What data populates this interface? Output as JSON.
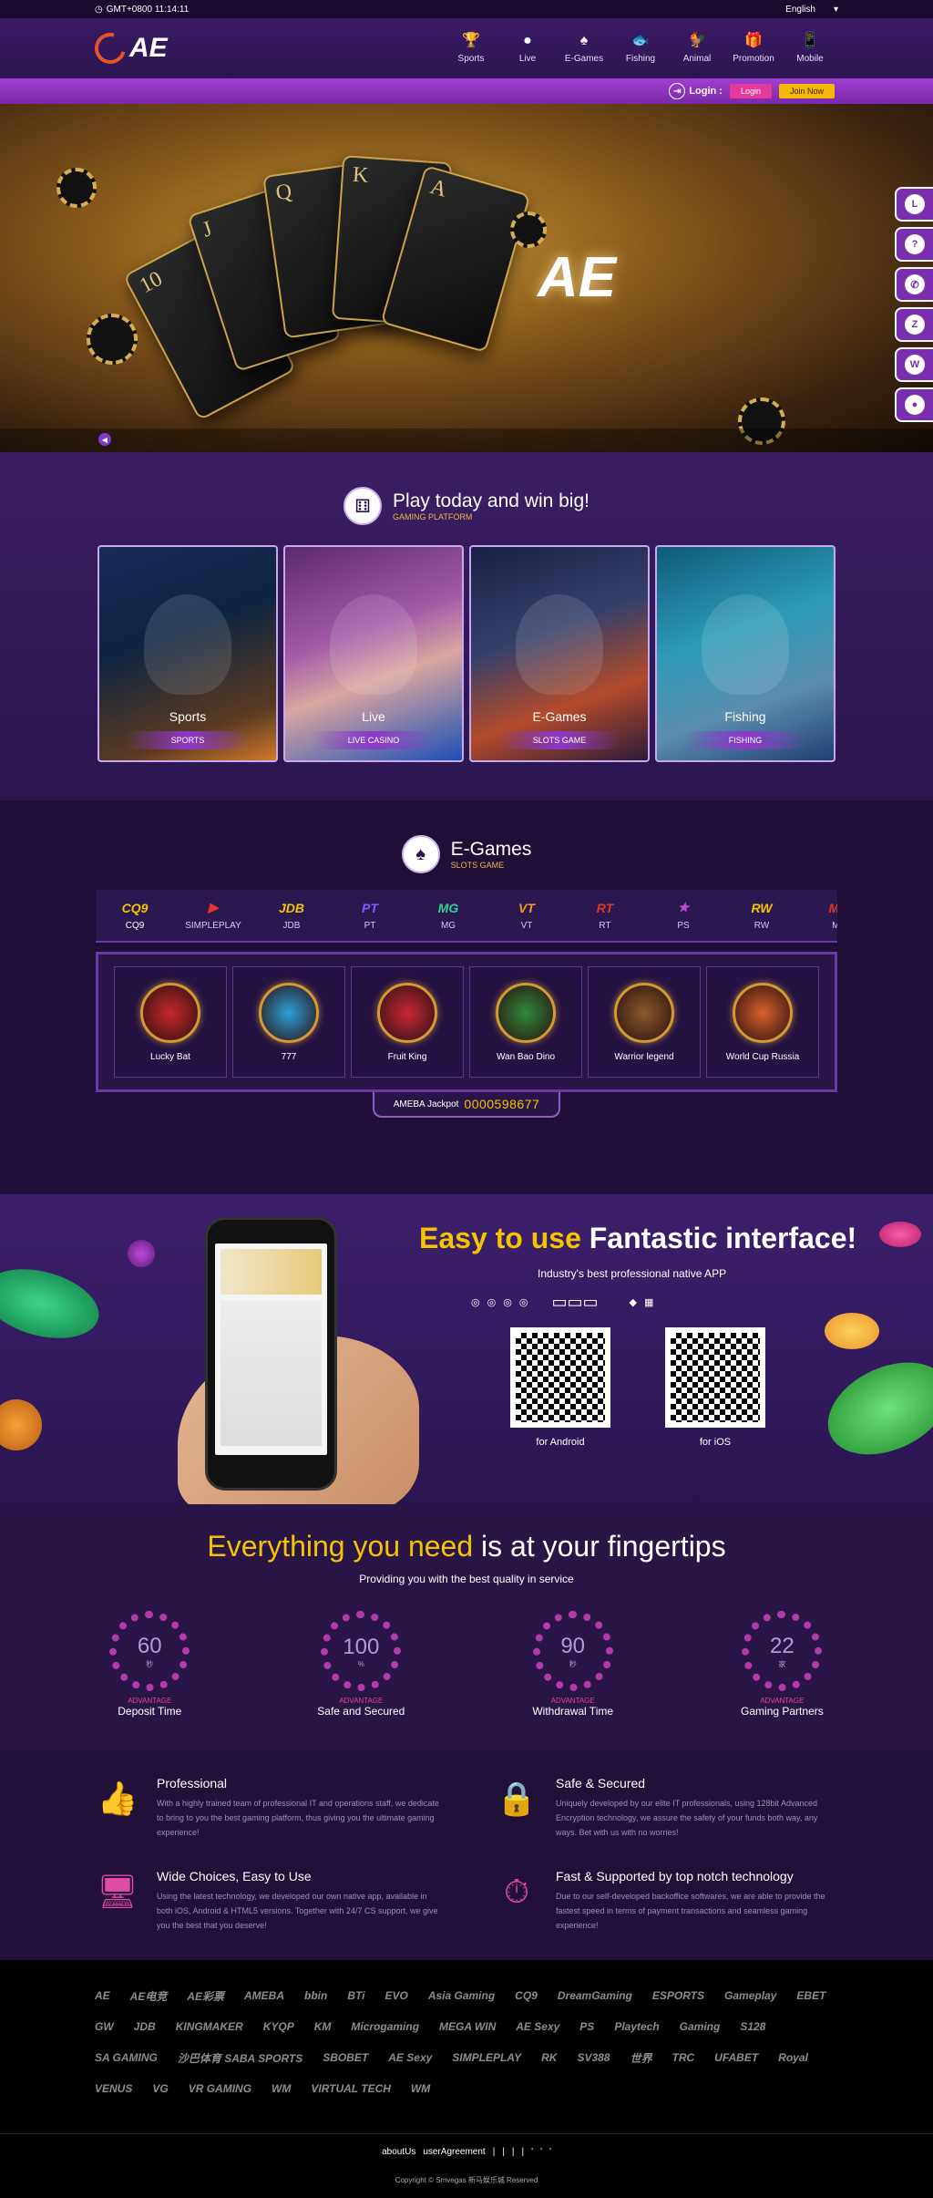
{
  "topbar": {
    "time": "GMT+0800 11:14:11",
    "language": "English"
  },
  "brand": {
    "logo": "AE",
    "banner_logo": "AE"
  },
  "nav": [
    {
      "label": "Sports",
      "icon": "trophy-icon",
      "glyph": "🏆"
    },
    {
      "label": "Live",
      "icon": "person-icon",
      "glyph": "●"
    },
    {
      "label": "E-Games",
      "icon": "spade-icon",
      "glyph": "♠"
    },
    {
      "label": "Fishing",
      "icon": "fish-icon",
      "glyph": "🐟"
    },
    {
      "label": "Animal",
      "icon": "rooster-icon",
      "glyph": "🐓"
    },
    {
      "label": "Promotion",
      "icon": "gift-bag-icon",
      "glyph": "🎁"
    },
    {
      "label": "Mobile",
      "icon": "phone-icon",
      "glyph": "📱"
    }
  ],
  "loginbar": {
    "label": "Login :",
    "login_button": "Login",
    "join_button": "Join Now"
  },
  "banner": {
    "cards": [
      "10",
      "J",
      "Q",
      "K",
      "A"
    ]
  },
  "float_buttons": [
    {
      "name": "line-icon",
      "glyph": "L"
    },
    {
      "name": "help-icon",
      "glyph": "?"
    },
    {
      "name": "phone-icon",
      "glyph": "✆"
    },
    {
      "name": "zalo-icon",
      "glyph": "Z"
    },
    {
      "name": "whatsapp-icon",
      "glyph": "W"
    },
    {
      "name": "user-icon",
      "glyph": "●"
    }
  ],
  "platform": {
    "title": "Play today and win big!",
    "subtitle": "GAMING PLATFORM",
    "games": [
      {
        "name": "Sports",
        "sub": "SPORTS"
      },
      {
        "name": "Live",
        "sub": "LIVE CASINO"
      },
      {
        "name": "E-Games",
        "sub": "SLOTS GAME"
      },
      {
        "name": "Fishing",
        "sub": "FISHING"
      }
    ]
  },
  "egames": {
    "title": "E-Games",
    "subtitle": "SLOTS GAME",
    "providers": [
      {
        "logo": "CQ9",
        "label": "CQ9",
        "color": "#f5c400"
      },
      {
        "logo": "▶",
        "label": "SIMPLEPLAY",
        "color": "#e8342a"
      },
      {
        "logo": "JDB",
        "label": "JDB",
        "color": "#f5c400"
      },
      {
        "logo": "PT",
        "label": "PT",
        "color": "#7a5cff"
      },
      {
        "logo": "MG",
        "label": "MG",
        "color": "#2fd28f"
      },
      {
        "logo": "VT",
        "label": "VT",
        "color": "#f59a1e"
      },
      {
        "logo": "RT",
        "label": "RT",
        "color": "#e8342a"
      },
      {
        "logo": "★",
        "label": "PS",
        "color": "#c64bd8"
      },
      {
        "logo": "RW",
        "label": "RW",
        "color": "#f5c400"
      },
      {
        "logo": "MW",
        "label": "MW",
        "color": "#e8342a"
      }
    ],
    "slots": [
      {
        "name": "Lucky Bat",
        "color": "#c8282b"
      },
      {
        "name": "777",
        "color": "#2c9fd8"
      },
      {
        "name": "Fruit King",
        "color": "#c8283a"
      },
      {
        "name": "Wan Bao Dino",
        "color": "#2f8a3a"
      },
      {
        "name": "Warrior legend",
        "color": "#8a5a2a"
      },
      {
        "name": "World Cup Russia",
        "color": "#d8622a"
      }
    ],
    "jackpot_label": "AMEBA Jackpot",
    "jackpot_value": "0000598677"
  },
  "app": {
    "title_highlight": "Easy to use",
    "title_rest": "Fantastic interface!",
    "subtitle": "Industry's best professional native APP",
    "android_label": "for Android",
    "ios_label": "for iOS"
  },
  "features": {
    "title_highlight": "Everything you need",
    "title_rest": "is at your fingertips",
    "subtitle": "Providing you with the best quality in service",
    "stats": [
      {
        "value": "60",
        "unit": "秒",
        "tag": "ADVANTAGE",
        "label": "Deposit Time"
      },
      {
        "value": "100",
        "unit": "%",
        "tag": "ADVANTAGE",
        "label": "Safe and Secured"
      },
      {
        "value": "90",
        "unit": "秒",
        "tag": "ADVANTAGE",
        "label": "Withdrawal Time"
      },
      {
        "value": "22",
        "unit": "家",
        "tag": "ADVANTAGE",
        "label": "Gaming Partners"
      }
    ]
  },
  "advantages": [
    {
      "title": "Professional",
      "icon": "thumbs-up-icon",
      "text": "With a highly trained team of professional IT and operations staff, we dedicate to bring to you the best gaming platform, thus giving you the ultimate gaming experience!"
    },
    {
      "title": "Safe & Secured",
      "icon": "lock-icon",
      "text": "Uniquely developed by our elite IT professionals, using 128bit Advanced Encryption technology, we assure the safety of your funds both way, any ways. Bet with us with no worries!"
    },
    {
      "title": "Wide Choices, Easy to Use",
      "icon": "devices-icon",
      "text": "Using the latest technology, we developed our own native app, available in both iOS, Android & HTML5 versions. Together with 24/7 CS support, we give you the best that you deserve!"
    },
    {
      "title": "Fast & Supported by top notch technology",
      "icon": "stopwatch-icon",
      "text": "Due to our self-developed backoffice softwares, we are able to provide the fastest speed in terms of payment transactions and seamless gaming experience!"
    }
  ],
  "partners": [
    "AE",
    "AE电竞",
    "AE彩票",
    "AMEBA",
    "bbin",
    "BTi",
    "EVO",
    "Asia Gaming",
    "CQ9",
    "DreamGaming",
    "ESPORTS",
    "Gameplay",
    "EBET",
    "GW",
    "JDB",
    "KINGMAKER",
    "KYQP",
    "KM",
    "Microgaming",
    "MEGA WIN",
    "AE Sexy",
    "PS",
    "Playtech",
    "Gaming",
    "S128",
    "SA GAMING",
    "沙巴体育 SABA SPORTS",
    "SBOBET",
    "AE Sexy",
    "SIMPLEPLAY",
    "RK",
    "SV388",
    "世界",
    "TRC",
    "UFABET",
    "Royal",
    "VENUS",
    "VG",
    "VR GAMING",
    "WM",
    "VIRTUAL TECH",
    "WM"
  ],
  "footer": {
    "links": [
      "aboutUs",
      "userAgreement",
      "|",
      "|",
      "|",
      "|",
      "'",
      "'",
      "'"
    ],
    "copyright": "Copyright © Smvegas 新马娱乐城 Reserved"
  }
}
